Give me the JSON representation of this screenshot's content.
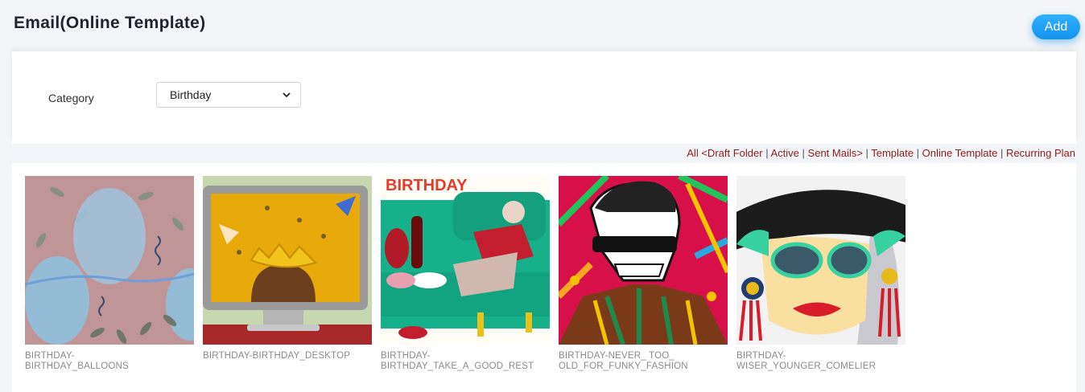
{
  "header": {
    "title": "Email(Online Template)",
    "add_label": "Add"
  },
  "filter": {
    "category_label": "Category",
    "category_value": "Birthday"
  },
  "nav": {
    "all": "All",
    "draft_folder": "<Draft Folder",
    "active": "Active",
    "sent_mails": "Sent Mails>",
    "template": "Template",
    "online_template": "Online Template",
    "recurring_plan": "Recurring Plan"
  },
  "templates": [
    {
      "name": "BIRTHDAY-\nBIRTHDAY_BALLOONS",
      "thumb_icon": "balloons-illustration"
    },
    {
      "name": "BIRTHDAY-BIRTHDAY_DESKTOP",
      "thumb_icon": "desktop-party-illustration"
    },
    {
      "name": "BIRTHDAY-\nBIRTHDAY_TAKE_A_GOOD_REST",
      "thumb_icon": "resting-person-illustration",
      "banner_text": "BIRTHDAY"
    },
    {
      "name": "BIRTHDAY-NEVER_ TOO_\nOLD_FOR_FUNKY_FASHION",
      "thumb_icon": "funky-skeleton-illustration"
    },
    {
      "name": "BIRTHDAY-\nWISER_YOUNGER_COMELIER",
      "thumb_icon": "stylish-lady-illustration"
    }
  ],
  "colors": {
    "accent": "#1e9bf5",
    "link": "#8b1a1a"
  }
}
